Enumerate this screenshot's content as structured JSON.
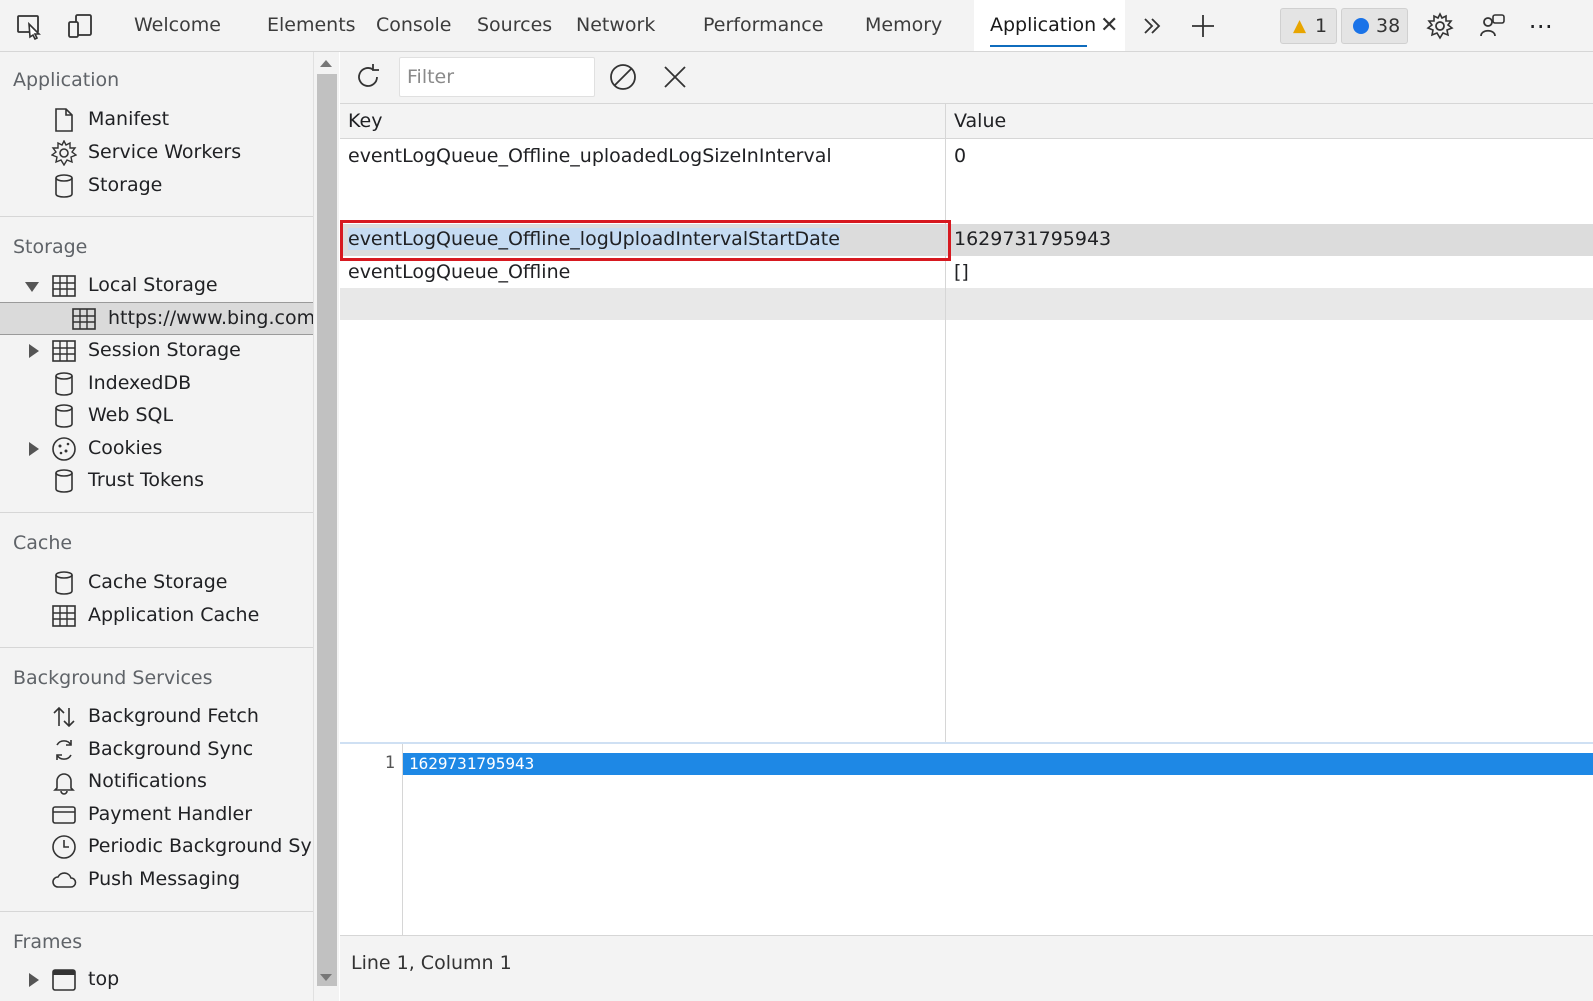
{
  "tabs": [
    {
      "label": "Welcome"
    },
    {
      "label": "Elements"
    },
    {
      "label": "Console"
    },
    {
      "label": "Sources"
    },
    {
      "label": "Network"
    },
    {
      "label": "Performance"
    },
    {
      "label": "Memory"
    },
    {
      "label": "Application"
    }
  ],
  "badges": {
    "warnings": "1",
    "messages": "38"
  },
  "sidebar": {
    "application": {
      "title": "Application",
      "items": [
        "Manifest",
        "Service Workers",
        "Storage"
      ]
    },
    "storage": {
      "title": "Storage",
      "local_storage": "Local Storage",
      "local_origin": "https://www.bing.com",
      "items": [
        "Session Storage",
        "IndexedDB",
        "Web SQL",
        "Cookies",
        "Trust Tokens"
      ]
    },
    "cache": {
      "title": "Cache",
      "items": [
        "Cache Storage",
        "Application Cache"
      ]
    },
    "background": {
      "title": "Background Services",
      "items": [
        "Background Fetch",
        "Background Sync",
        "Notifications",
        "Payment Handler",
        "Periodic Background Sync",
        "Push Messaging"
      ]
    },
    "frames": {
      "title": "Frames",
      "items": [
        "top"
      ]
    }
  },
  "toolbar": {
    "filter_placeholder": "Filter"
  },
  "table": {
    "headers": {
      "key": "Key",
      "value": "Value"
    },
    "rows": [
      {
        "key": "eventLogQueue_Offline_uploadedLogSizeInInterval",
        "value": "0"
      },
      {
        "key": "eventLogQueue_Offline_logUploadIntervalStartDate",
        "value": "1629731795943"
      },
      {
        "key": "eventLogQueue_Offline",
        "value": "[]"
      }
    ]
  },
  "editor": {
    "line_number": "1",
    "line_value": "1629731795943"
  },
  "status": {
    "position": "Line 1, Column 1"
  },
  "colors": {
    "accent": "#0f6cbd",
    "selection": "#1e88e5",
    "highlight_box": "#d71920"
  }
}
